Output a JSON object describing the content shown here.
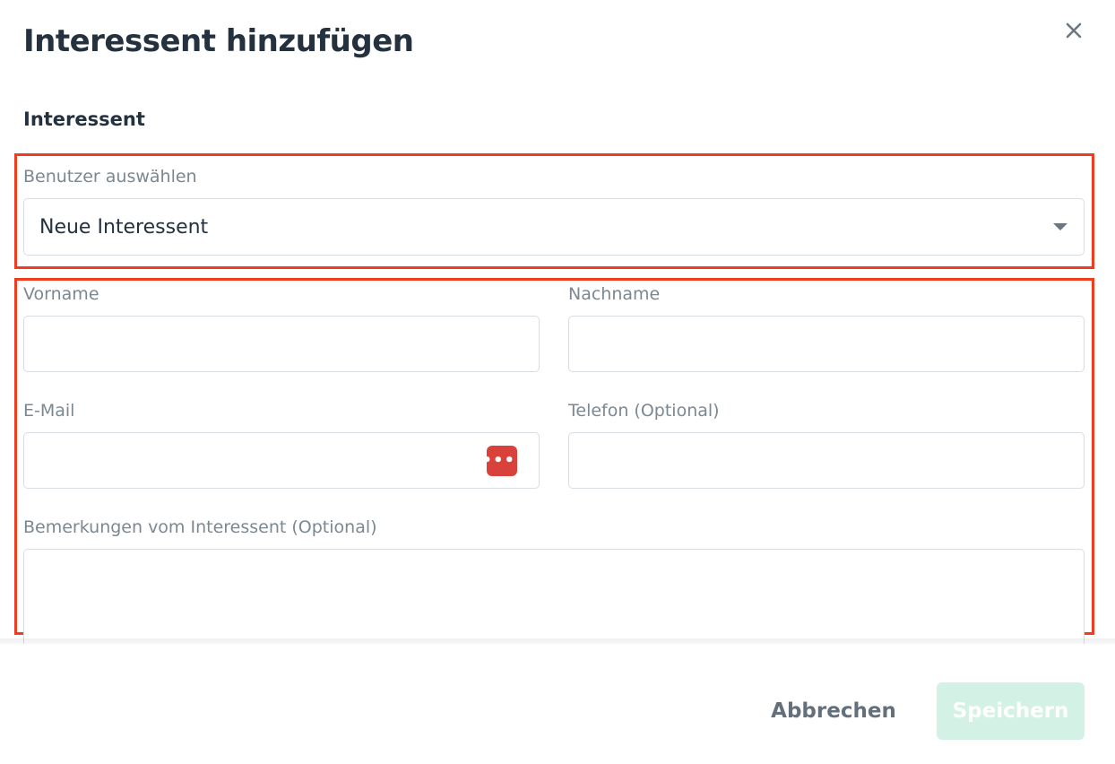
{
  "dialog": {
    "title": "Interessent hinzufügen",
    "close_icon": "close-icon"
  },
  "section": {
    "title": "Interessent"
  },
  "user_select": {
    "label": "Benutzer auswählen",
    "value": "Neue Interessent",
    "icon": "caret-down-icon"
  },
  "fields": {
    "first_name": {
      "label": "Vorname",
      "value": ""
    },
    "last_name": {
      "label": "Nachname",
      "value": ""
    },
    "email": {
      "label": "E-Mail",
      "value": "",
      "icon": "password-manager-icon",
      "icon_text": "•••|"
    },
    "phone": {
      "label": "Telefon (Optional)",
      "value": ""
    },
    "remarks": {
      "label": "Bemerkungen vom Interessent (Optional)",
      "value": ""
    }
  },
  "footer": {
    "cancel_label": "Abbrechen",
    "save_label": "Speichern"
  },
  "colors": {
    "highlight": "#f03c1f",
    "save_disabled": "#d3f2e5",
    "password_icon": "#d9413b"
  }
}
